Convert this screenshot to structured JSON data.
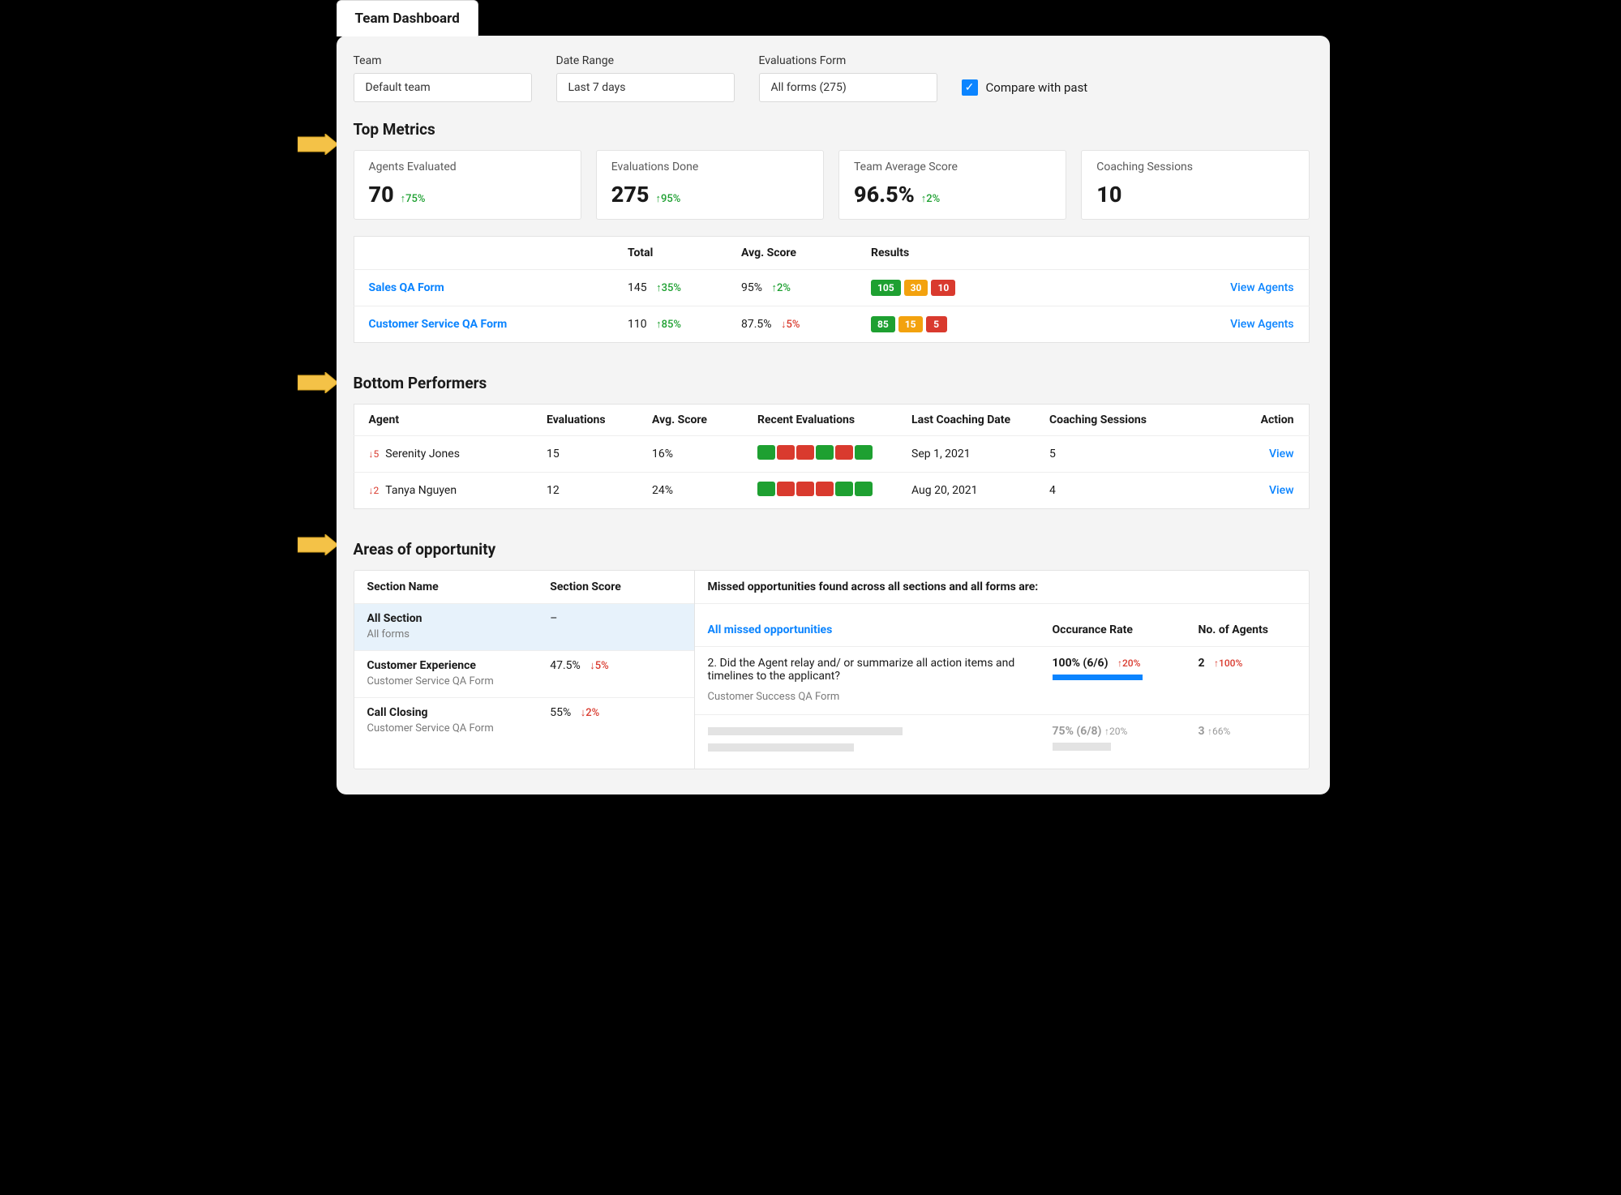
{
  "tab": "Team Dashboard",
  "filters": {
    "team_label": "Team",
    "team_value": "Default team",
    "date_label": "Date Range",
    "date_value": "Last 7 days",
    "form_label": "Evaluations Form",
    "form_value": "All forms (275)",
    "compare_label": "Compare with past",
    "compare_checked": true
  },
  "sections": {
    "top_metrics": "Top Metrics",
    "bottom_performers": "Bottom Performers",
    "opportunity": "Areas of opportunity"
  },
  "metrics": [
    {
      "label": "Agents Evaluated",
      "value": "70",
      "delta": "↑75%",
      "dir": "up"
    },
    {
      "label": "Evaluations Done",
      "value": "275",
      "delta": "↑95%",
      "dir": "up"
    },
    {
      "label": "Team Average Score",
      "value": "96.5%",
      "delta": "↑2%",
      "dir": "up"
    },
    {
      "label": "Coaching Sessions",
      "value": "10",
      "delta": "",
      "dir": ""
    }
  ],
  "forms_table": {
    "headers": {
      "total": "Total",
      "avg": "Avg. Score",
      "results": "Results",
      "action": "View Agents"
    },
    "rows": [
      {
        "name": "Sales QA Form",
        "total": "145",
        "total_delta": "↑35%",
        "total_dir": "up",
        "avg": "95%",
        "avg_delta": "↑2%",
        "avg_dir": "up",
        "results": {
          "g": "105",
          "y": "30",
          "r": "10"
        }
      },
      {
        "name": "Customer Service QA Form",
        "total": "110",
        "total_delta": "↑85%",
        "total_dir": "up",
        "avg": "87.5%",
        "avg_delta": "↓5%",
        "avg_dir": "down",
        "results": {
          "g": "85",
          "y": "15",
          "r": "5"
        }
      }
    ]
  },
  "bottom": {
    "headers": {
      "agent": "Agent",
      "evals": "Evaluations",
      "avg": "Avg. Score",
      "recent": "Recent Evaluations",
      "last_coach": "Last Coaching Date",
      "sessions": "Coaching Sessions",
      "action": "Action"
    },
    "rows": [
      {
        "rank_change": "↓5",
        "name": "Serenity Jones",
        "evals": "15",
        "avg": "16%",
        "recent": [
          "g",
          "r",
          "r",
          "g",
          "r",
          "g"
        ],
        "last_coach": "Sep 1, 2021",
        "sessions": "5",
        "action": "View"
      },
      {
        "rank_change": "↓2",
        "name": "Tanya Nguyen",
        "evals": "12",
        "avg": "24%",
        "recent": [
          "g",
          "r",
          "r",
          "r",
          "g",
          "g"
        ],
        "last_coach": "Aug 20, 2021",
        "sessions": "4",
        "action": "View"
      }
    ]
  },
  "opp": {
    "left_headers": {
      "name": "Section Name",
      "score": "Section Score"
    },
    "sections_list": [
      {
        "title": "All Section",
        "sub": "All forms",
        "score": "–",
        "delta": "",
        "dir": "",
        "selected": true
      },
      {
        "title": "Customer Experience",
        "sub": "Customer Service QA Form",
        "score": "47.5%",
        "delta": "↓5%",
        "dir": "down"
      },
      {
        "title": "Call Closing",
        "sub": "Customer Service QA Form",
        "score": "55%",
        "delta": "↓2%",
        "dir": "down"
      }
    ],
    "right_desc": "Missed opportunities found across all sections and all forms are:",
    "right_headers": {
      "name": "All missed opportunities",
      "rate": "Occurance Rate",
      "agents": "No. of Agents"
    },
    "right_rows": [
      {
        "q": "2. Did the Agent relay and/ or summarize all action items and timelines to the applicant?",
        "form": "Customer Success QA Form",
        "rate": "100% (6/6)",
        "rate_delta": "↑20%",
        "rate_dir": "down",
        "bar_pct": 62,
        "agents": "2",
        "agents_delta": "↑100%",
        "agents_dir": "down",
        "placeholder": false
      },
      {
        "placeholder": true,
        "rate": "75% (6/8)",
        "rate_delta": "↑20%",
        "rate_dir": "gray",
        "agents": "3",
        "agents_delta": "↑66%",
        "agents_dir": "gray",
        "bar_pct": 40
      }
    ]
  }
}
